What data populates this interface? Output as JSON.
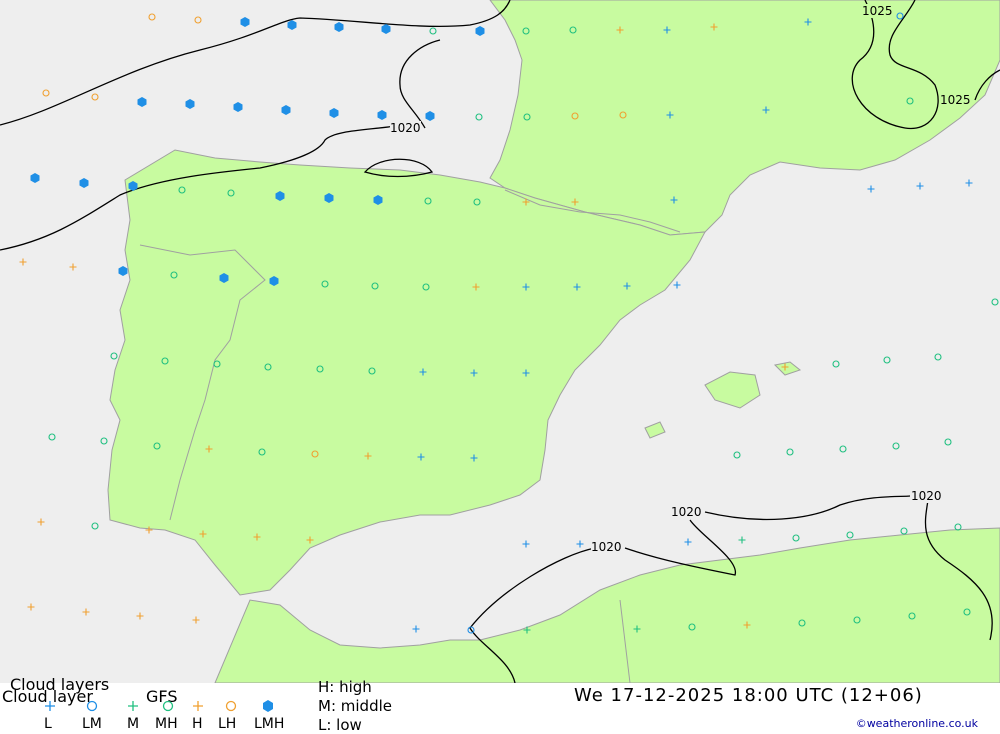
{
  "title_line1": "Cloud layers",
  "title_line2": "Cloud layer",
  "model": "GFS",
  "levels": {
    "high": "H: high",
    "middle": "M: middle",
    "low": "L: low"
  },
  "datetime": "We 17-12-2025 18:00 UTC (12+06)",
  "credit": "©weatheronline.co.uk",
  "legend": [
    {
      "code": "L",
      "symbol": "+",
      "color": "#1f8fe6"
    },
    {
      "code": "LM",
      "symbol": "o",
      "color": "#1f8fe6"
    },
    {
      "code": "M",
      "symbol": "+",
      "color": "#20c080"
    },
    {
      "code": "MH",
      "symbol": "o",
      "color": "#20c080"
    },
    {
      "code": "H",
      "symbol": "+",
      "color": "#f0a030"
    },
    {
      "code": "LH",
      "symbol": "o",
      "color": "#f0a030"
    },
    {
      "code": "LMH",
      "symbol": "hex",
      "color": "#1f8fe6"
    }
  ],
  "isobar_labels": [
    "1020",
    "1025",
    "1025",
    "1020",
    "1020",
    "1020"
  ],
  "colors": {
    "land": "#c8fba0",
    "sea": "#eeeeee",
    "coast": "#a0a0a0",
    "isobar": "#000000",
    "blue": "#1f8fe6",
    "green": "#20c080",
    "orange": "#f0a030"
  }
}
